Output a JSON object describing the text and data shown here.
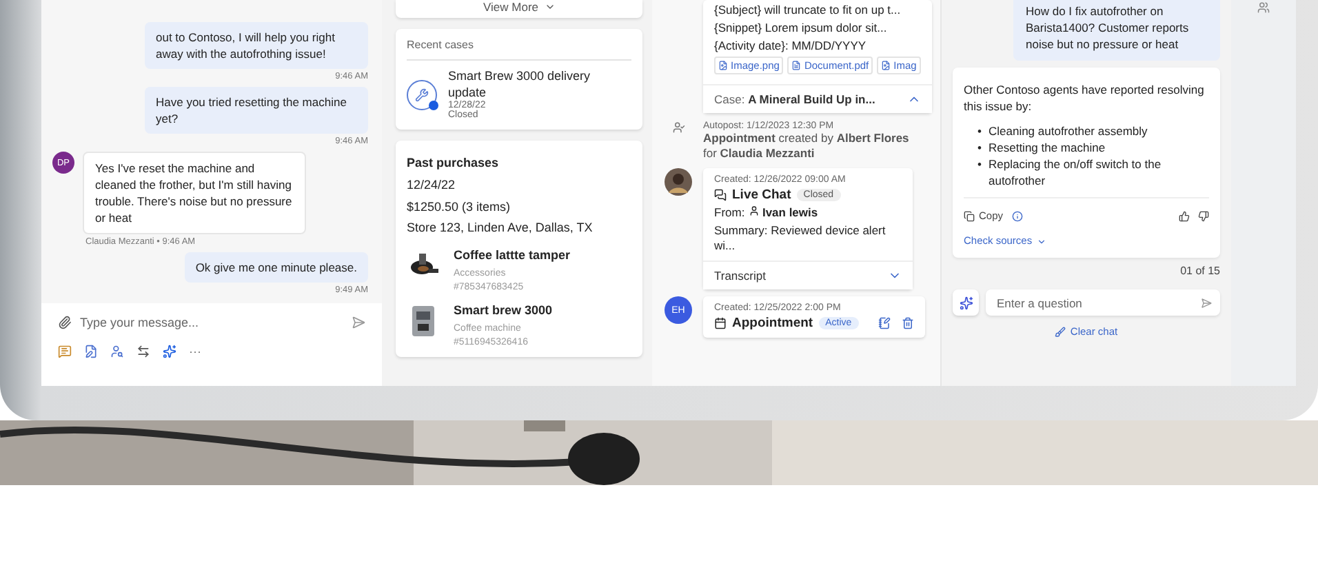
{
  "chat": {
    "messages": [
      {
        "kind": "agent",
        "text": "out to Contoso, I will help you right away with the autofrothing issue!",
        "time": "9:46 AM"
      },
      {
        "kind": "agent",
        "text": "Have you tried resetting the machine yet?",
        "time": "9:46 AM"
      },
      {
        "kind": "customer",
        "avatar": "DP",
        "text": "Yes I've reset the machine and cleaned the frother, but I'm still having trouble. There's noise but no pressure or heat",
        "time": "Claudia Mezzanti • 9:46 AM"
      },
      {
        "kind": "agent",
        "text": "Ok give me one minute please.",
        "time": "9:49 AM"
      }
    ],
    "composer": {
      "placeholder": "Type your message...",
      "more": "···"
    }
  },
  "customer": {
    "view_more": "View More",
    "recent_cases": {
      "title": "Recent cases",
      "items": [
        {
          "title": "Smart Brew 3000 delivery update",
          "date": "12/28/22",
          "status": "Closed"
        }
      ]
    },
    "past_purchases": {
      "title": "Past purchases",
      "date": "12/24/22",
      "total": "$1250.50 (3 items)",
      "store": "Store 123, Linden Ave, Dallas, TX",
      "items": [
        {
          "kind": "tamper",
          "name": "Coffee lattte tamper",
          "category": "Accessories",
          "sku": "#785347683425"
        },
        {
          "kind": "machine",
          "name": "Smart brew 3000",
          "category": "Coffee machine",
          "sku": "#5116945326416"
        }
      ]
    }
  },
  "timeline": {
    "email_card": {
      "lines": [
        "{Subject} will truncate to fit on up t...",
        "{Snippet} Lorem ipsum dolor sit...",
        "{Activity date}: MM/DD/YYYY"
      ],
      "attachments": [
        "Image.png",
        "Document.pdf",
        "Imag"
      ],
      "case_label": "Case:",
      "case_value": "A Mineral Build Up in...",
      "expanded": true
    },
    "autopost": {
      "meta": "Autopost: 1/12/2023 12:30 PM",
      "text": "**Appointment** created by **Albert Flores** for **Claudia Mezzanti**"
    },
    "entries": [
      {
        "kind": "chat",
        "created": "Created: 12/26/2022 09:00 AM",
        "title": "Live Chat",
        "badge": "Closed",
        "active": false,
        "from_label": "From:",
        "from_name": "Ivan lewis",
        "summary": "Summary: Reviewed device alert wi...",
        "footer": "Transcript"
      },
      {
        "kind": "appointment",
        "avatar": "EH",
        "created": "Created: 12/25/2022 2:00 PM",
        "title": "Appointment",
        "badge": "Active",
        "active": true
      }
    ]
  },
  "copilot": {
    "question": "How do I fix autofrother on Barista1400? Customer reports noise but no pressure or heat",
    "answer": {
      "intro": "Other Contoso agents have reported resolving this issue by:",
      "marker": "•",
      "bullets": [
        "Cleaning autofrother assembly",
        "Resetting the machine",
        "Replacing the on/off switch to the autofrother"
      ],
      "copy": "Copy",
      "sources": "Check sources"
    },
    "counter": "01 of 15",
    "input": {
      "placeholder": "Enter a question"
    },
    "clear": "Clear chat"
  }
}
